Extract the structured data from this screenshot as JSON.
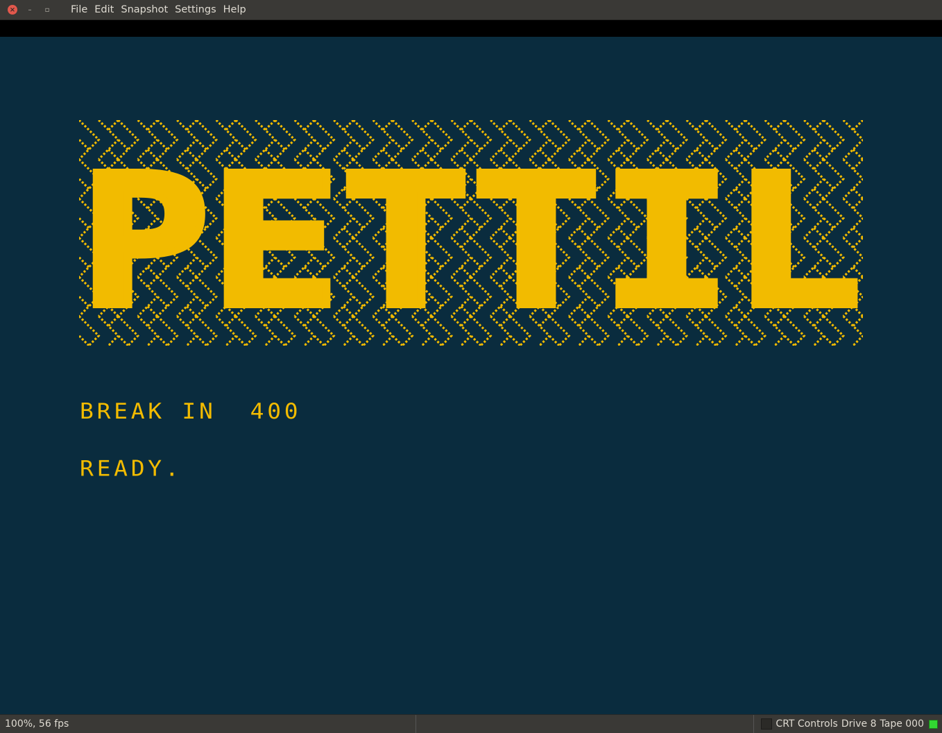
{
  "menu": [
    "File",
    "Edit",
    "Snapshot",
    "Settings",
    "Help"
  ],
  "screen": {
    "logo_text": "PETTIL",
    "lines": [
      "BREAK IN  400",
      "READY."
    ]
  },
  "status": {
    "fps": "100%, 56 fps",
    "crt_controls": "CRT Controls",
    "drive": "Drive 8",
    "tape": "Tape 000"
  },
  "colors": {
    "screen_bg": "#0a2c3e",
    "phosphor": "#f2bb00",
    "led": "#32d732"
  }
}
